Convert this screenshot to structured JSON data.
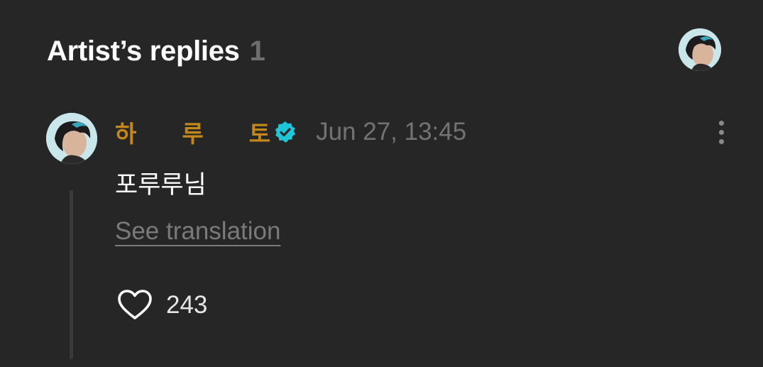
{
  "header": {
    "title": "Artist’s replies",
    "count": "1",
    "avatar_icon": "artist-avatar"
  },
  "comment": {
    "author": "하루토",
    "verified_icon": "verified-badge-icon",
    "verified_color": "#1ec6d8",
    "author_color": "#c4881a",
    "timestamp": "Jun 27, 13:45",
    "text": "포루루님",
    "translation_link": "See translation",
    "like_count": "243",
    "more_icon": "more-vertical-icon",
    "like_icon": "heart-outline-icon"
  }
}
